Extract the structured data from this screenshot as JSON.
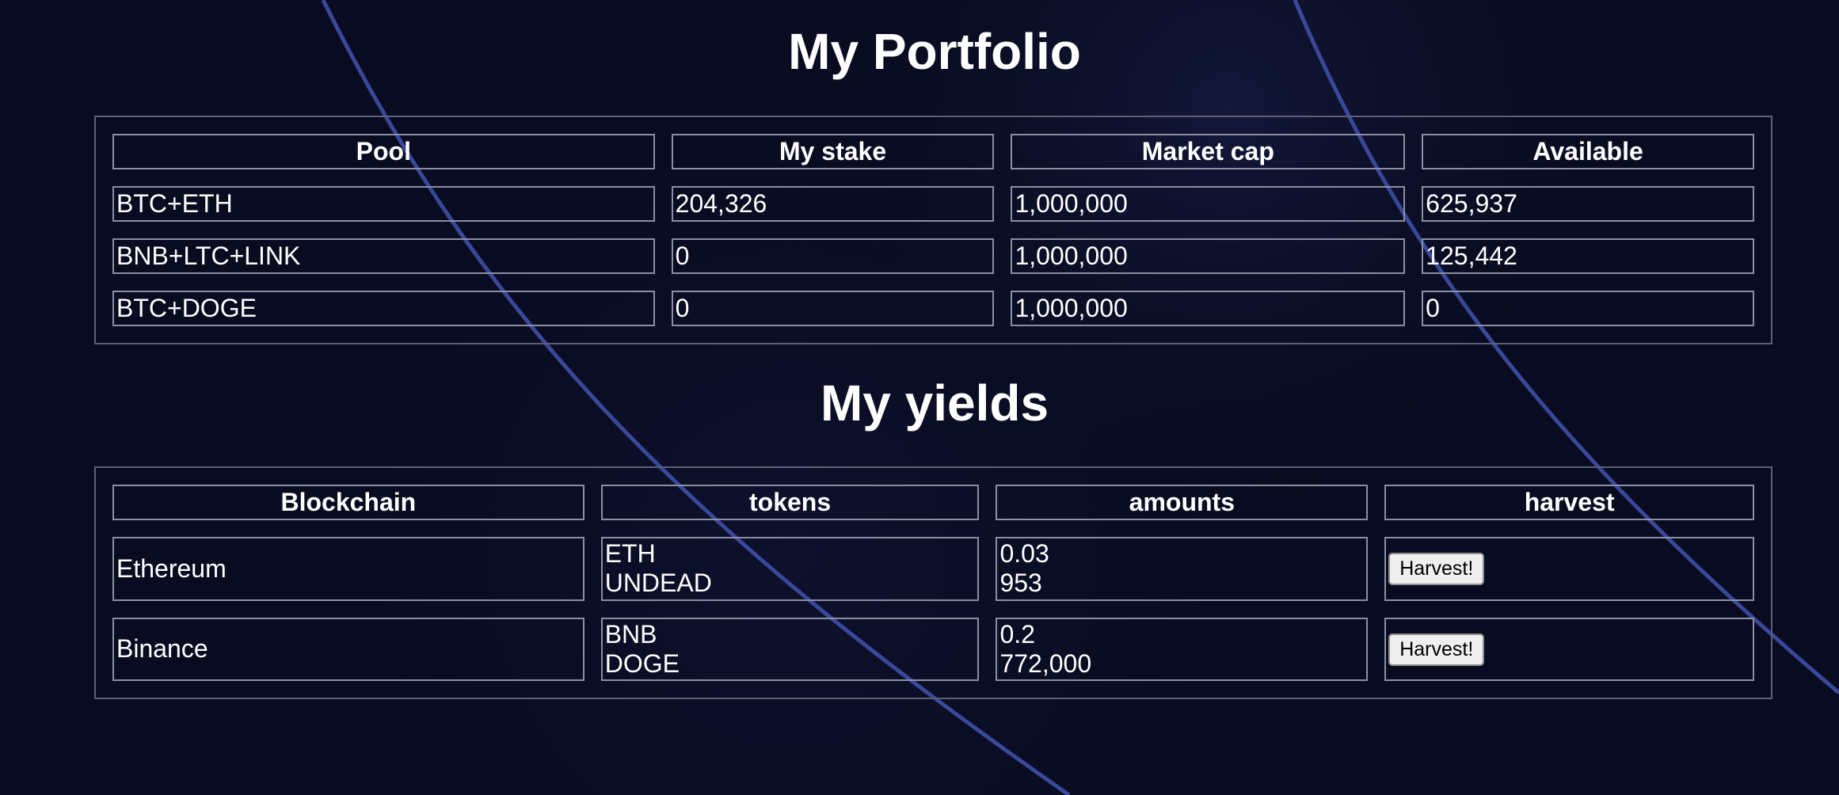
{
  "portfolio": {
    "title": "My Portfolio",
    "headers": [
      "Pool",
      "My stake",
      "Market cap",
      "Available"
    ],
    "rows": [
      [
        "BTC+ETH",
        "204,326",
        "1,000,000",
        "625,937"
      ],
      [
        "BNB+LTC+LINK",
        "0",
        "1,000,000",
        "125,442"
      ],
      [
        "BTC+DOGE",
        "0",
        "1,000,000",
        "0"
      ]
    ]
  },
  "yields": {
    "title": "My yields",
    "headers": [
      "Blockchain",
      "tokens",
      "amounts",
      "harvest"
    ],
    "rows": [
      {
        "blockchain": "Ethereum",
        "tokens": [
          "ETH",
          "UNDEAD"
        ],
        "amounts": [
          "0.03",
          "953"
        ],
        "button": "Harvest!"
      },
      {
        "blockchain": "Binance",
        "tokens": [
          "BNB",
          "DOGE"
        ],
        "amounts": [
          "0.2",
          "772,000"
        ],
        "button": "Harvest!"
      }
    ]
  },
  "colors": {
    "background": "#090c20",
    "accent_lines": "#3f4fa8",
    "text": "#ffffff",
    "border": "#8a8fa3"
  }
}
